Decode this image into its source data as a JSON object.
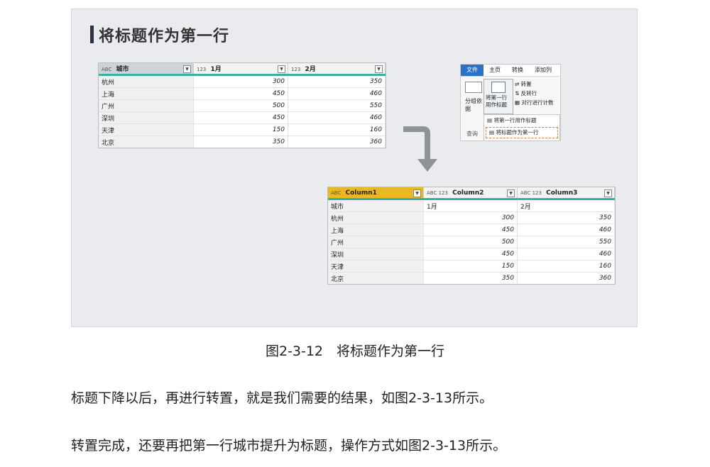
{
  "figure": {
    "title": "将标题作为第一行",
    "top_table": {
      "headers": [
        {
          "type": "ABC",
          "label": "城市"
        },
        {
          "type": "123",
          "label": "1月"
        },
        {
          "type": "123",
          "label": "2月"
        }
      ],
      "rows": [
        [
          "杭州",
          "300",
          "350"
        ],
        [
          "上海",
          "450",
          "460"
        ],
        [
          "广州",
          "500",
          "550"
        ],
        [
          "深圳",
          "450",
          "460"
        ],
        [
          "天津",
          "150",
          "160"
        ],
        [
          "北京",
          "350",
          "360"
        ]
      ]
    },
    "ribbon": {
      "tabs": [
        "文件",
        "主页",
        "转换",
        "添加列"
      ],
      "group_by": "分组依据",
      "use_first_row": "将第一行用作标题",
      "transpose": "转置",
      "reverse_rows": "反转行",
      "count_rows": "对行进行计数",
      "menu_item1": "将第一行用作标题",
      "menu_item2": "将标题作为第一行",
      "query": "查询"
    },
    "bottom_table": {
      "headers": [
        {
          "type": "ABC",
          "label": "Column1"
        },
        {
          "type": "ABC 123",
          "label": "Column2"
        },
        {
          "type": "ABC 123",
          "label": "Column3"
        }
      ],
      "rows": [
        [
          "城市",
          "1月",
          "2月"
        ],
        [
          "杭州",
          "300",
          "350"
        ],
        [
          "上海",
          "450",
          "460"
        ],
        [
          "广州",
          "500",
          "550"
        ],
        [
          "深圳",
          "450",
          "460"
        ],
        [
          "天津",
          "150",
          "160"
        ],
        [
          "北京",
          "350",
          "360"
        ]
      ]
    }
  },
  "caption": "图2-3-12　将标题作为第一行",
  "paragraph1": "标题下降以后，再进行转置，就是我们需要的结果，如图2-3-13所示。",
  "paragraph2": "转置完成，还要再把第一行城市提升为标题，操作方式如图2-3-13所示。"
}
